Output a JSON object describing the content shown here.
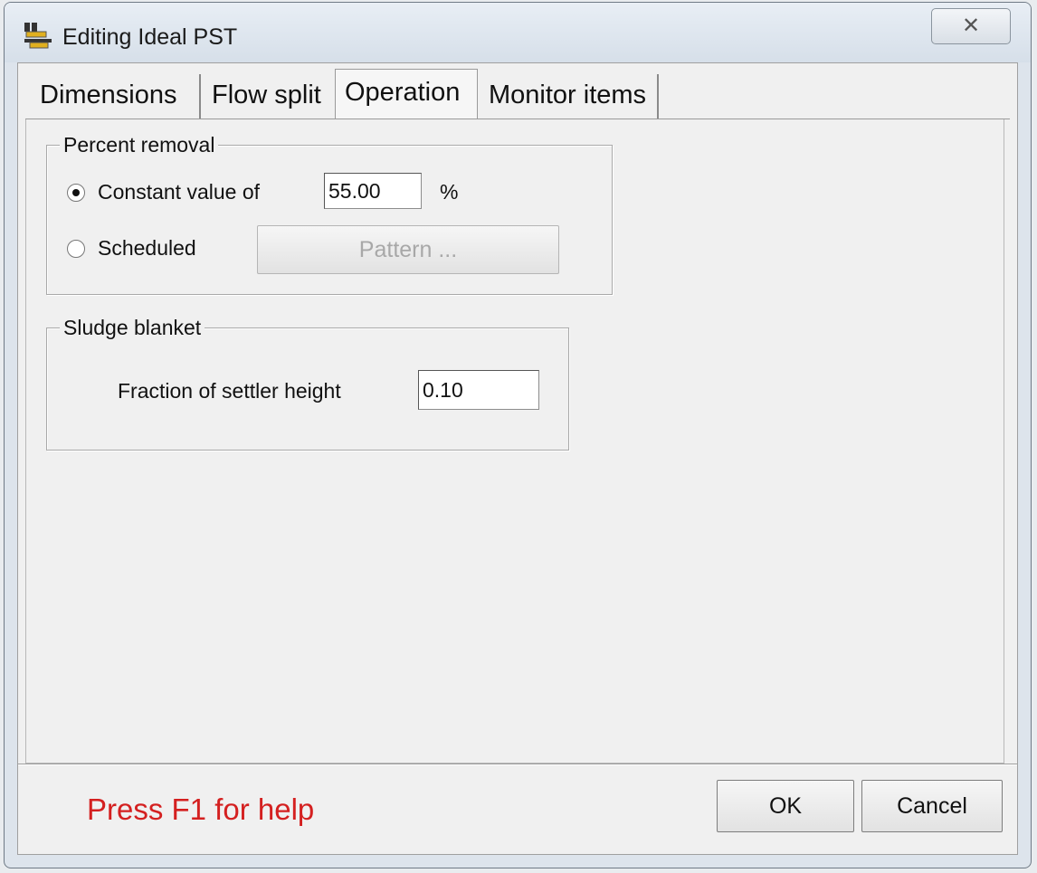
{
  "window": {
    "title": "Editing Ideal PST",
    "close_glyph": "✕",
    "icon": "clarifier-icon"
  },
  "tabs": [
    {
      "label": "Dimensions",
      "active": false
    },
    {
      "label": "Flow split",
      "active": false
    },
    {
      "label": "Operation",
      "active": true
    },
    {
      "label": "Monitor items",
      "active": false
    }
  ],
  "percent_removal": {
    "group_label": "Percent removal",
    "constant_label": "Constant value of",
    "constant_value": "55.00",
    "unit": "%",
    "scheduled_label": "Scheduled",
    "pattern_button": "Pattern ...",
    "selected": "constant"
  },
  "sludge_blanket": {
    "group_label": "Sludge blanket",
    "fraction_label": "Fraction of settler height",
    "fraction_value": "0.10"
  },
  "footer": {
    "help_text": "Press F1 for help",
    "ok_label": "OK",
    "cancel_label": "Cancel"
  },
  "colors": {
    "help_text": "#d42020"
  }
}
